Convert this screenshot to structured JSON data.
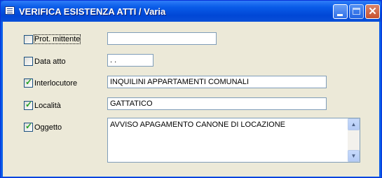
{
  "window": {
    "title": "VERIFICA ESISTENZA ATTI / Varia"
  },
  "titlebar": {
    "close_glyph": "✕"
  },
  "fields": [
    {
      "label": "Prot. mittente",
      "checked": false,
      "value": ""
    },
    {
      "label": "Data atto",
      "checked": false,
      "value": " .  ."
    },
    {
      "label": "Interlocutore",
      "checked": true,
      "value": "INQUILINI APPARTAMENTI COMUNALI"
    },
    {
      "label": "Località",
      "checked": true,
      "value": "GATTATICO"
    },
    {
      "label": "Oggetto",
      "checked": true,
      "value": "AVVISO APAGAMENTO CANONE DI LOCAZIONE"
    }
  ],
  "check_glyph": "✓",
  "icons": [
    "app-form-icon",
    "minimize-icon",
    "maximize-icon",
    "close-icon",
    "scroll-up-icon",
    "scroll-down-icon"
  ]
}
